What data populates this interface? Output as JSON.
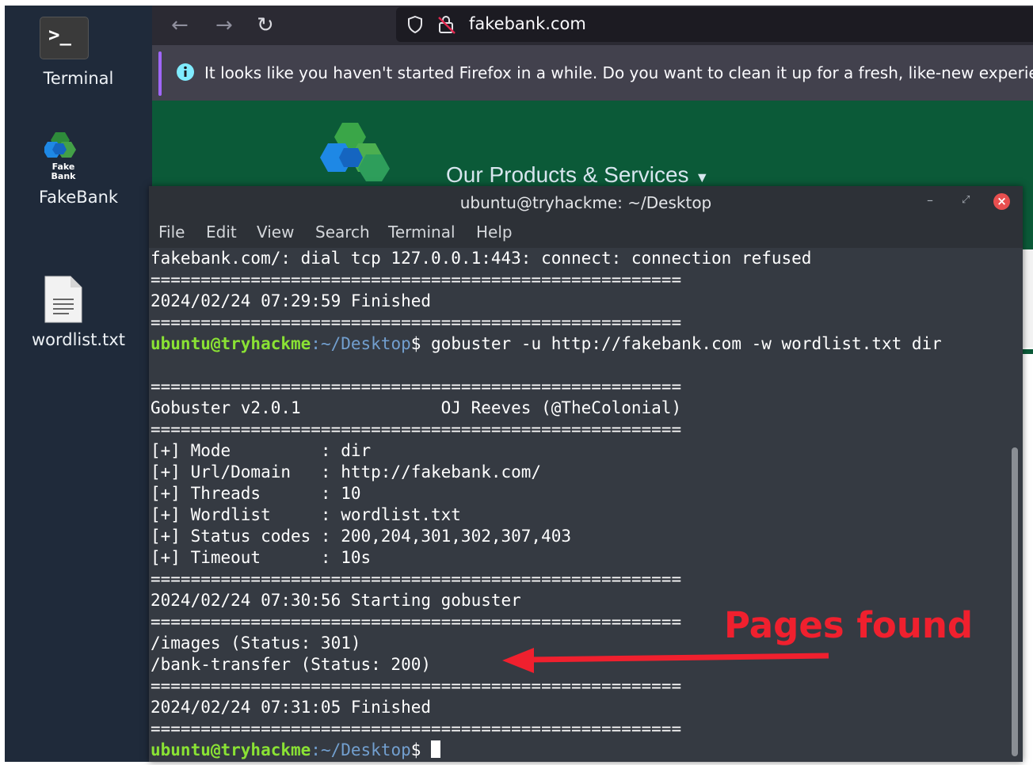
{
  "desktop": {
    "icons": [
      {
        "label": "Terminal",
        "icon": "terminal-icon"
      },
      {
        "label": "FakeBank",
        "icon": "fakebank-logo-icon",
        "logo_text": [
          "Fake",
          "Bank"
        ]
      },
      {
        "label": "wordlist.txt",
        "icon": "text-file-icon"
      }
    ]
  },
  "browser": {
    "url": "fakebank.com",
    "notification": "It looks like you haven't started Firefox in a while. Do you want to clean it up for a fresh, like-new experien",
    "site_nav": "Our Products & Services",
    "colors": {
      "site_bg": "#0b5a38",
      "toolbar": "#2b2a33"
    }
  },
  "terminal": {
    "title": "ubuntu@tryhackme: ~/Desktop",
    "menu": [
      "File",
      "Edit",
      "View",
      "Search",
      "Terminal",
      "Help"
    ],
    "prompt_user": "ubuntu@tryhackme",
    "prompt_path": ":~/Desktop",
    "prompt_symbol": "$",
    "command": " gobuster -u http://fakebank.com -w wordlist.txt dir",
    "lines": [
      "fakebank.com/: dial tcp 127.0.0.1:443: connect: connection refused",
      "=====================================================",
      "2024/02/24 07:29:59 Finished",
      "=====================================================",
      "",
      "",
      "=====================================================",
      "Gobuster v2.0.1              OJ Reeves (@TheColonial)",
      "=====================================================",
      "[+] Mode         : dir",
      "[+] Url/Domain   : http://fakebank.com/",
      "[+] Threads      : 10",
      "[+] Wordlist     : wordlist.txt",
      "[+] Status codes : 200,204,301,302,307,403",
      "[+] Timeout      : 10s",
      "=====================================================",
      "2024/02/24 07:30:56 Starting gobuster",
      "=====================================================",
      "/images (Status: 301)",
      "/bank-transfer (Status: 200)",
      "=====================================================",
      "2024/02/24 07:31:05 Finished",
      "====================================================="
    ]
  },
  "annotation": {
    "text": "Pages found",
    "color": "#f0202e"
  }
}
